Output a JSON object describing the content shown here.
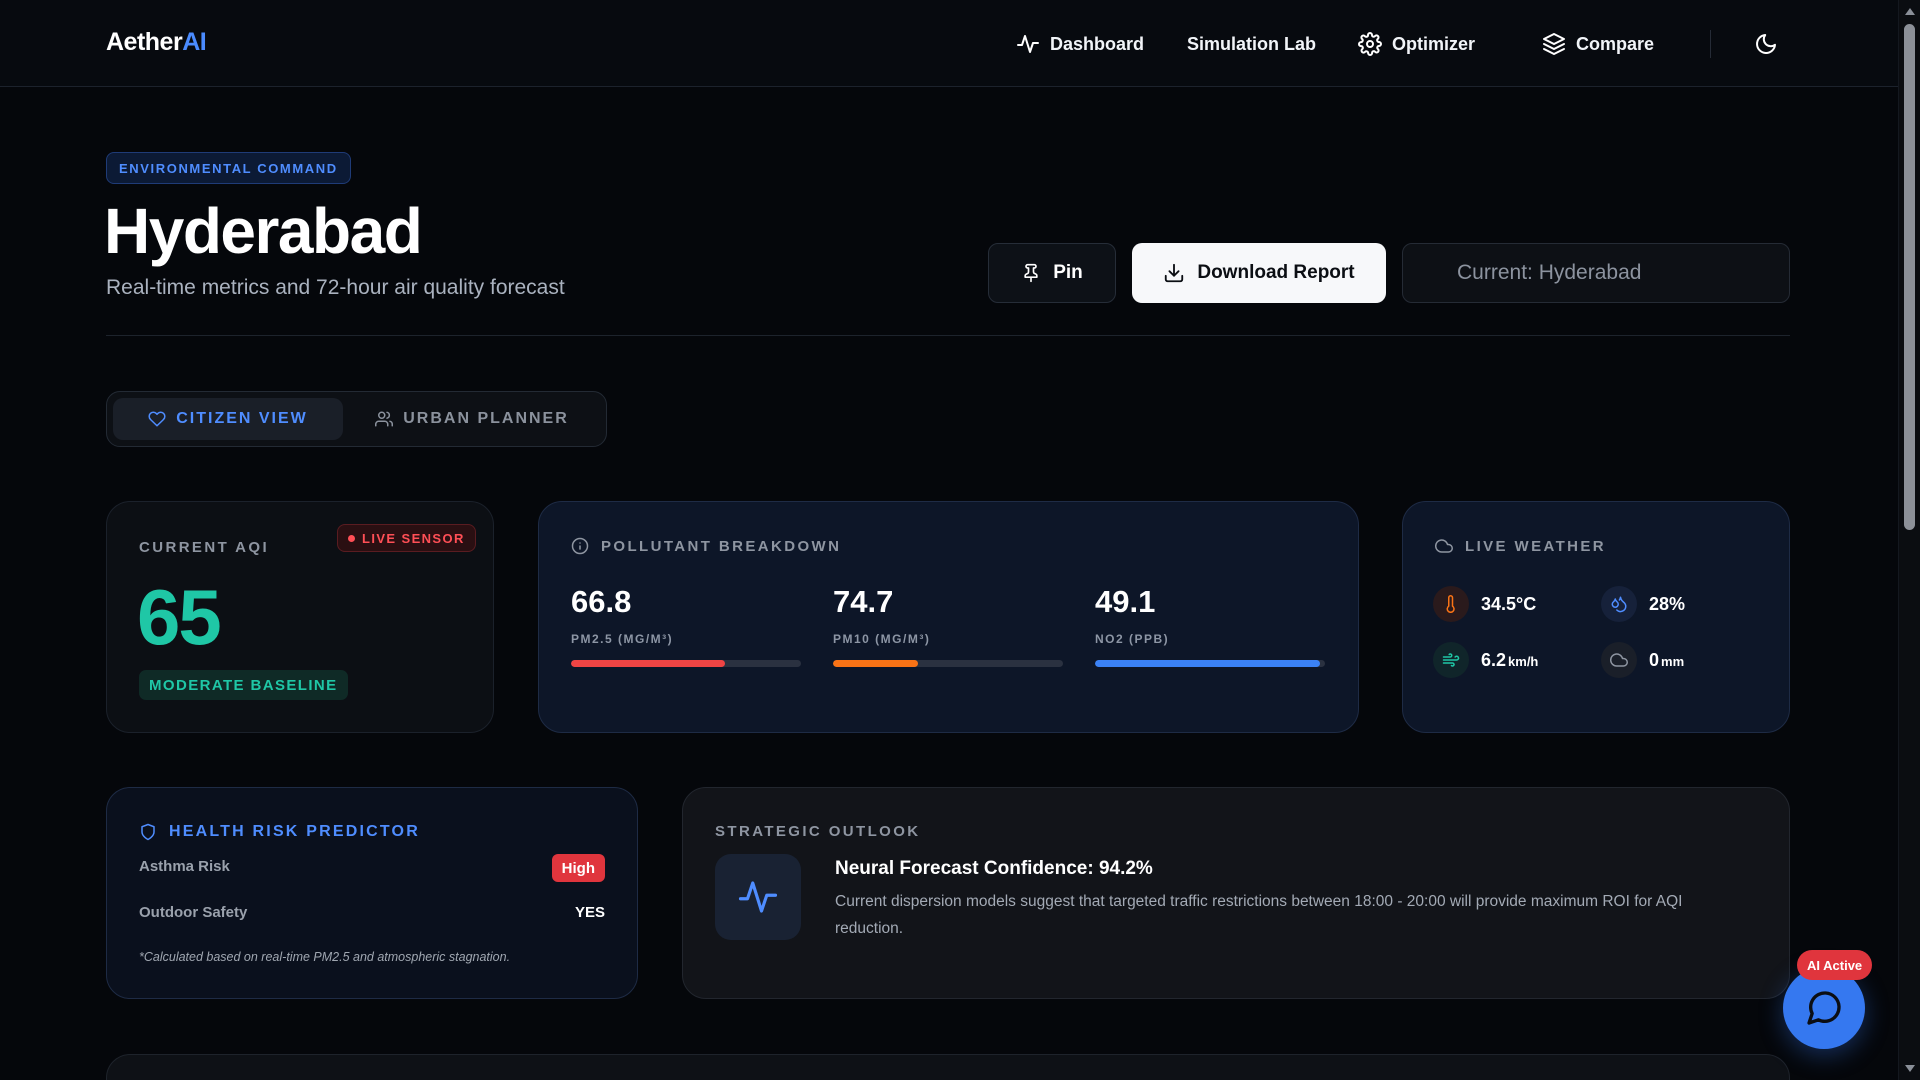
{
  "nav": {
    "logo_main": "Aether",
    "logo_accent": "AI",
    "items": [
      {
        "label": "Dashboard",
        "icon": "activity-icon"
      },
      {
        "label": "Simulation Lab",
        "icon": ""
      },
      {
        "label": "Optimizer",
        "icon": "gear-icon"
      },
      {
        "label": "Compare",
        "icon": "layers-icon"
      }
    ],
    "theme_icon": "moon-icon"
  },
  "header": {
    "badge": "ENVIRONMENTAL COMMAND",
    "title": "Hyderabad",
    "subtitle": "Real-time metrics and 72-hour air quality forecast",
    "pin_label": "Pin",
    "download_label": "Download Report",
    "city_placeholder": "Current: Hyderabad"
  },
  "views": {
    "citizen": "CITIZEN VIEW",
    "planner": "URBAN PLANNER",
    "active": "citizen"
  },
  "aqi": {
    "label": "CURRENT AQI",
    "live": "LIVE SENSOR",
    "value": "65",
    "status": "MODERATE BASELINE",
    "color": "#1fc7a6"
  },
  "pollutants": {
    "label": "POLLUTANT BREAKDOWN",
    "items": [
      {
        "value": "66.8",
        "unit": "PM2.5 (MG/M³)",
        "fill": 0.67,
        "color": "#ef4444"
      },
      {
        "value": "74.7",
        "unit": "PM10 (MG/M³)",
        "fill": 0.37,
        "color": "#f97316"
      },
      {
        "value": "49.1",
        "unit": "NO2 (PPB)",
        "fill": 0.98,
        "color": "#3b82f6"
      }
    ]
  },
  "weather": {
    "label": "LIVE WEATHER",
    "temperature": "34.5°C",
    "humidity": "28%",
    "wind_value": "6.2",
    "wind_unit": "km/h",
    "rain_value": "0",
    "rain_unit": "mm"
  },
  "health": {
    "title": "HEALTH RISK PREDICTOR",
    "asthma_label": "Asthma Risk",
    "asthma_value": "High",
    "outdoor_label": "Outdoor Safety",
    "outdoor_value": "YES",
    "note": "*Calculated based on real-time PM2.5 and atmospheric stagnation."
  },
  "outlook": {
    "label": "STRATEGIC OUTLOOK",
    "title": "Neural Forecast Confidence: 94.2%",
    "text": "Current dispersion models suggest that targeted traffic restrictions between 18:00 - 20:00 will provide maximum ROI for AQI reduction."
  },
  "chat": {
    "badge": "AI Active"
  }
}
